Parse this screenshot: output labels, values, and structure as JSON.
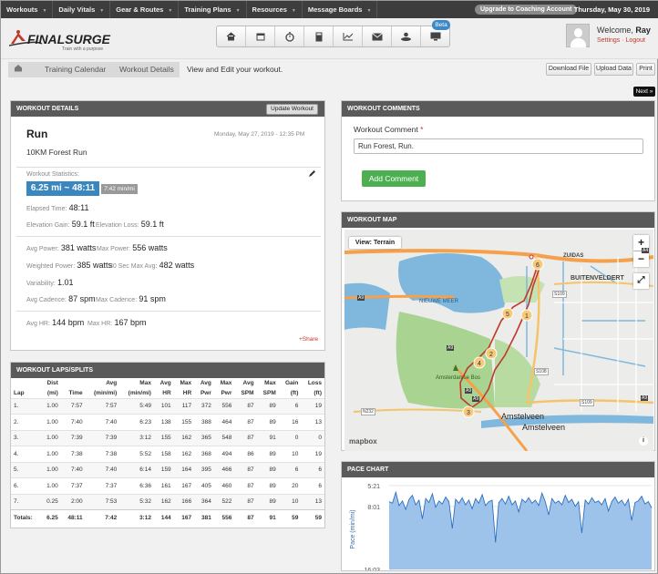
{
  "nav": {
    "items": [
      "Workouts",
      "Daily Vitals",
      "Gear & Routes",
      "Training Plans",
      "Resources",
      "Message Boards"
    ],
    "upgrade": "Upgrade to Coaching Account",
    "date": "Thursday, May 30, 2019"
  },
  "header": {
    "logo_text": "FINALSURGE",
    "logo_tagline": "Train with a purpose",
    "beta": "Beta",
    "welcome": "Welcome,",
    "user": "Ray",
    "settings": "Settings",
    "logout": "Logout",
    "toolbar_icons": [
      "home-icon",
      "calendar-icon",
      "stopwatch-icon",
      "calculator-icon",
      "chart-icon",
      "mail-icon",
      "people-icon",
      "monitor-icon"
    ]
  },
  "breadcrumb": {
    "calendar": "Training Calendar",
    "details": "Workout Details",
    "description": "View and Edit your workout.",
    "download": "Download File",
    "upload": "Upload Data",
    "print": "Print",
    "next": "Next »"
  },
  "details": {
    "header": "WORKOUT DETAILS",
    "update": "Update Workout",
    "type": "Run",
    "datetime": "Monday, May 27, 2019 - 12:35 PM",
    "name": "10KM Forest Run",
    "stats_label": "Workout Statistics:",
    "stats_main": "6.25 mi ~ 48:11",
    "stats_pace": "7:42 min/mi",
    "elapsed_label": "Elapsed Time:",
    "elapsed": "48:11",
    "gain_label": "Elevation Gain:",
    "gain": "59.1 ft",
    "loss_label": "Elevation Loss:",
    "loss": "59.1 ft",
    "avgpower_label": "Avg Power:",
    "avgpower": "381 watts",
    "maxpower_label": "Max Power:",
    "maxpower": "556 watts",
    "wpower_label": "Weighted Power:",
    "wpower": "385 watts",
    "max30_label": "30 Sec Max Avg:",
    "max30": "482 watts",
    "variability_label": "Variability:",
    "variability": "1.01",
    "avgcad_label": "Avg Cadence:",
    "avgcad": "87 spm",
    "maxcad_label": "Max Cadence:",
    "maxcad": "91 spm",
    "avghr_label": "Avg HR:",
    "avghr": "144 bpm",
    "maxhr_label": "Max HR:",
    "maxhr": "167 bpm",
    "share": "+Share"
  },
  "laps": {
    "header": "WORKOUT LAPS/SPLITS",
    "head_top": [
      "",
      "Dist",
      "",
      "Avg",
      "Max",
      "Avg",
      "Max",
      "Avg",
      "Max",
      "Avg",
      "Max",
      "Gain",
      "Loss"
    ],
    "head_bottom": [
      "Lap",
      "(mi)",
      "Time",
      "(min/mi)",
      "(min/mi)",
      "HR",
      "HR",
      "Pwr",
      "Pwr",
      "SPM",
      "SPM",
      "(ft)",
      "(ft)"
    ],
    "rows": [
      [
        "1.",
        "1.00",
        "7:57",
        "7:57",
        "5:49",
        "101",
        "117",
        "372",
        "556",
        "87",
        "89",
        "6",
        "19"
      ],
      [
        "2.",
        "1.00",
        "7:40",
        "7:40",
        "6:23",
        "138",
        "155",
        "388",
        "464",
        "87",
        "89",
        "16",
        "13"
      ],
      [
        "3.",
        "1.00",
        "7:39",
        "7:39",
        "3:12",
        "155",
        "162",
        "365",
        "548",
        "87",
        "91",
        "0",
        "0"
      ],
      [
        "4.",
        "1.00",
        "7:38",
        "7:38",
        "5:52",
        "158",
        "162",
        "368",
        "494",
        "86",
        "89",
        "10",
        "19"
      ],
      [
        "5.",
        "1.00",
        "7:40",
        "7:40",
        "6:14",
        "159",
        "164",
        "395",
        "466",
        "87",
        "89",
        "6",
        "6"
      ],
      [
        "6.",
        "1.00",
        "7:37",
        "7:37",
        "6:36",
        "161",
        "167",
        "405",
        "460",
        "87",
        "89",
        "20",
        "6"
      ],
      [
        "7.",
        "0.25",
        "2:00",
        "7:53",
        "5:32",
        "162",
        "166",
        "364",
        "522",
        "87",
        "89",
        "10",
        "13"
      ]
    ],
    "totals": [
      "Totals:",
      "6.25",
      "48:11",
      "7:42",
      "3:12",
      "144",
      "167",
      "381",
      "556",
      "87",
      "91",
      "59",
      "59"
    ]
  },
  "comments": {
    "header": "WORKOUT COMMENTS",
    "label": "Workout Comment",
    "required_mark": "*",
    "value": "Run Forest, Run.",
    "button": "Add Comment"
  },
  "map": {
    "header": "WORKOUT MAP",
    "view": "View: Terrain",
    "zoom_in": "+",
    "zoom_out": "−",
    "labels": [
      "ZUIDAS",
      "BUITENVELDERT",
      "NIEUWE MEER",
      "Amsterdamse Bos",
      "Amstelveen",
      "Amstelveen",
      "S109",
      "S108",
      "S109",
      "A4",
      "A9",
      "A9",
      "N232",
      "A9",
      "A9",
      "A9"
    ],
    "markers": [
      "1",
      "2",
      "3",
      "4",
      "5",
      "6"
    ],
    "attribution": "mapbox"
  },
  "pace": {
    "header": "PACE CHART",
    "ylabel": "Pace (min/mi)",
    "yticks": [
      "5:21",
      "8:01",
      "16:03"
    ]
  },
  "chart_data": {
    "type": "area",
    "title": "PACE CHART",
    "ylabel": "Pace (min/mi)",
    "y_ticks": [
      "5:21",
      "8:01",
      "16:03"
    ],
    "y_inverted": true,
    "series": [
      {
        "values_min_per_mi": [
          7.4,
          7.6,
          6.2,
          7.9,
          7.3,
          8.4,
          7.1,
          6.6,
          7.8,
          7.2,
          9.6,
          7.0,
          7.5,
          6.4,
          8.1,
          7.3,
          7.7,
          6.8,
          7.4,
          10.8,
          7.1,
          7.6,
          6.9,
          7.8,
          7.2,
          8.3,
          7.0,
          7.6,
          6.5,
          7.9,
          7.4,
          7.2,
          12.6,
          7.5,
          7.0,
          7.7,
          6.7,
          7.8,
          7.3,
          8.7,
          7.1,
          7.5,
          6.9,
          7.6,
          7.2,
          7.9,
          6.3,
          7.4,
          9.1,
          7.0,
          7.6,
          7.3,
          7.8,
          6.6,
          7.5,
          7.1,
          8.0,
          7.4,
          11.4,
          7.2,
          7.7,
          6.9,
          7.5,
          7.3,
          7.8,
          7.0,
          8.6,
          7.4,
          6.8,
          7.6,
          7.2,
          7.9,
          7.1,
          9.8,
          7.5,
          7.3,
          6.7,
          7.7,
          7.4,
          8.2
        ]
      }
    ]
  }
}
